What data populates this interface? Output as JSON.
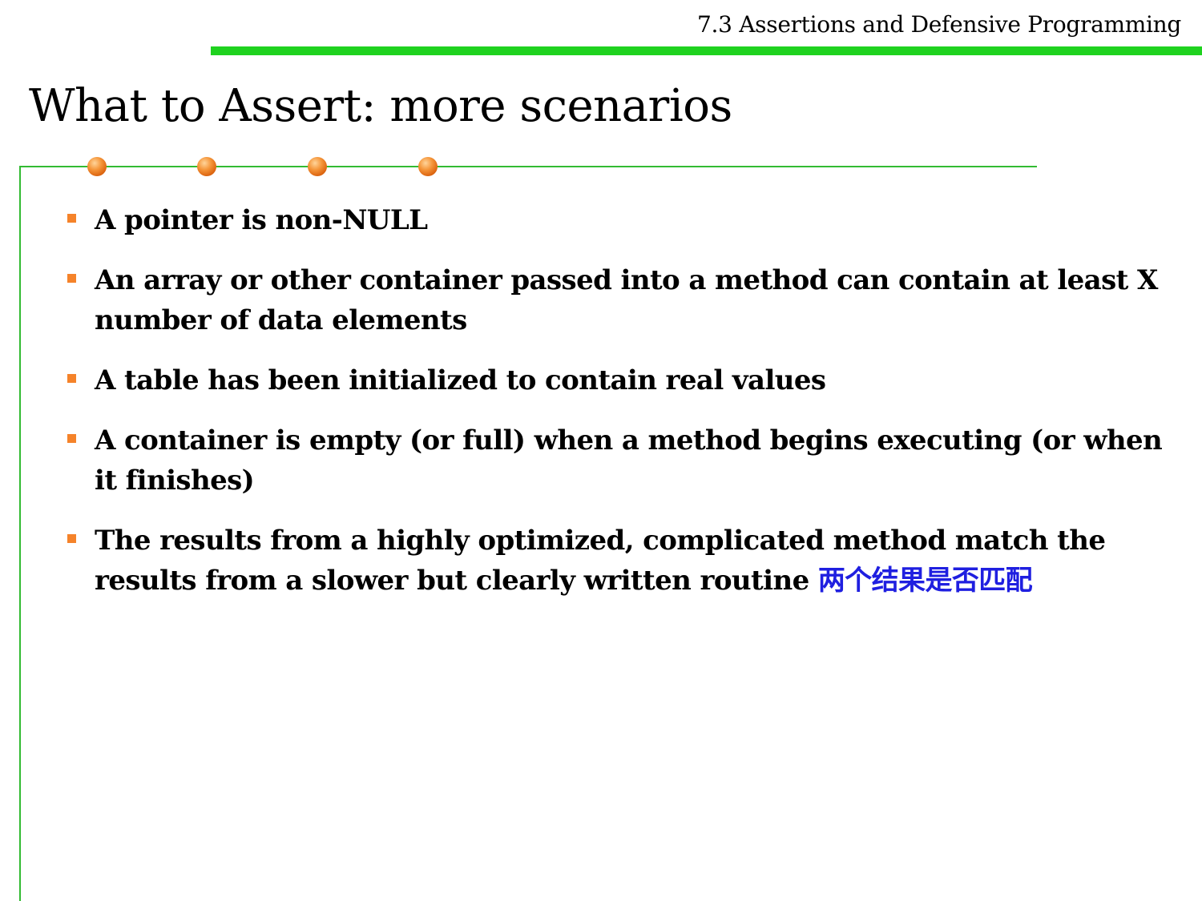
{
  "header": {
    "section": "7.3 Assertions and Defensive Programming"
  },
  "title": "What to Assert: more scenarios",
  "colors": {
    "accent_bar": "#1fd21f",
    "rule": "#33bb33",
    "bullet": "#f5832a",
    "dot": "#dd6611",
    "note": "#1f1fe0"
  },
  "decorations": {
    "dot_count": 4,
    "icon": "orange-dot-icon"
  },
  "bullets": [
    {
      "text": "A pointer is non-NULL",
      "note": ""
    },
    {
      "text": "An array or other container passed into a method can contain at least X number of data elements",
      "note": ""
    },
    {
      "text": "A table has been initialized to contain real values",
      "note": ""
    },
    {
      "text": "A container is empty (or full) when a method begins executing (or when it finishes)",
      "note": ""
    },
    {
      "text": "The results from a highly optimized, complicated method match the results from a slower but clearly written routine",
      "note": "两个结果是否匹配"
    }
  ]
}
